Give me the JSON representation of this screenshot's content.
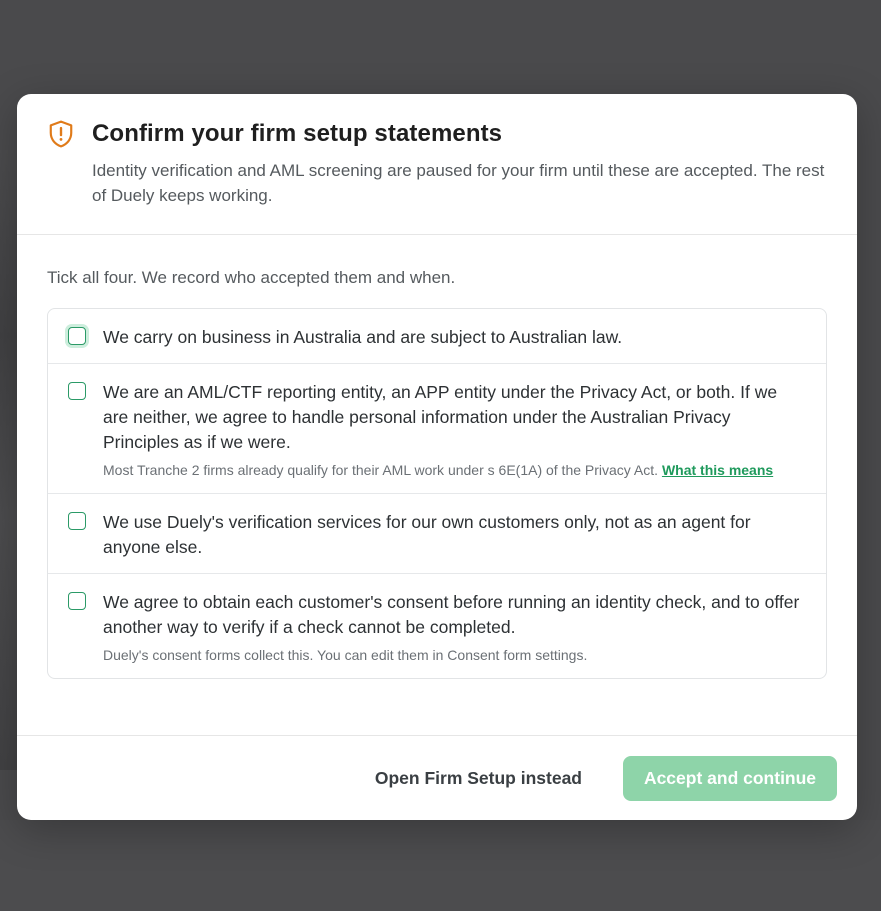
{
  "modal": {
    "title": "Confirm your firm setup statements",
    "subtitle": "Identity verification and AML screening are paused for your firm until these are accepted. The rest of Duely keeps working.",
    "intro": "Tick all four. We record who accepted them and when.",
    "statements": [
      {
        "text": "We carry on business in Australia and are subject to Australian law.",
        "checked": false
      },
      {
        "text": "We are an AML/CTF reporting entity, an APP entity under the Privacy Act, or both. If we are neither, we agree to handle personal information under the Australian Privacy Principles as if we were.",
        "note": "Most Tranche 2 firms already qualify for their AML work under s 6E(1A) of the Privacy Act.",
        "link": "What this means",
        "checked": false
      },
      {
        "text": "We use Duely's verification services for our own customers only, not as an agent for anyone else.",
        "checked": false
      },
      {
        "text": "We agree to obtain each customer's consent before running an identity check, and to offer another way to verify if a check cannot be completed.",
        "note": "Duely's consent forms collect this. You can edit them in Consent form settings.",
        "checked": false
      }
    ],
    "secondary_button": "Open Firm Setup instead",
    "primary_button": "Accept and continue"
  },
  "colors": {
    "accent": "#2b9a67",
    "primary_disabled": "#8ed4a9",
    "warning_icon": "#e07b1a"
  },
  "icons": {
    "header": "shield-alert-icon"
  }
}
